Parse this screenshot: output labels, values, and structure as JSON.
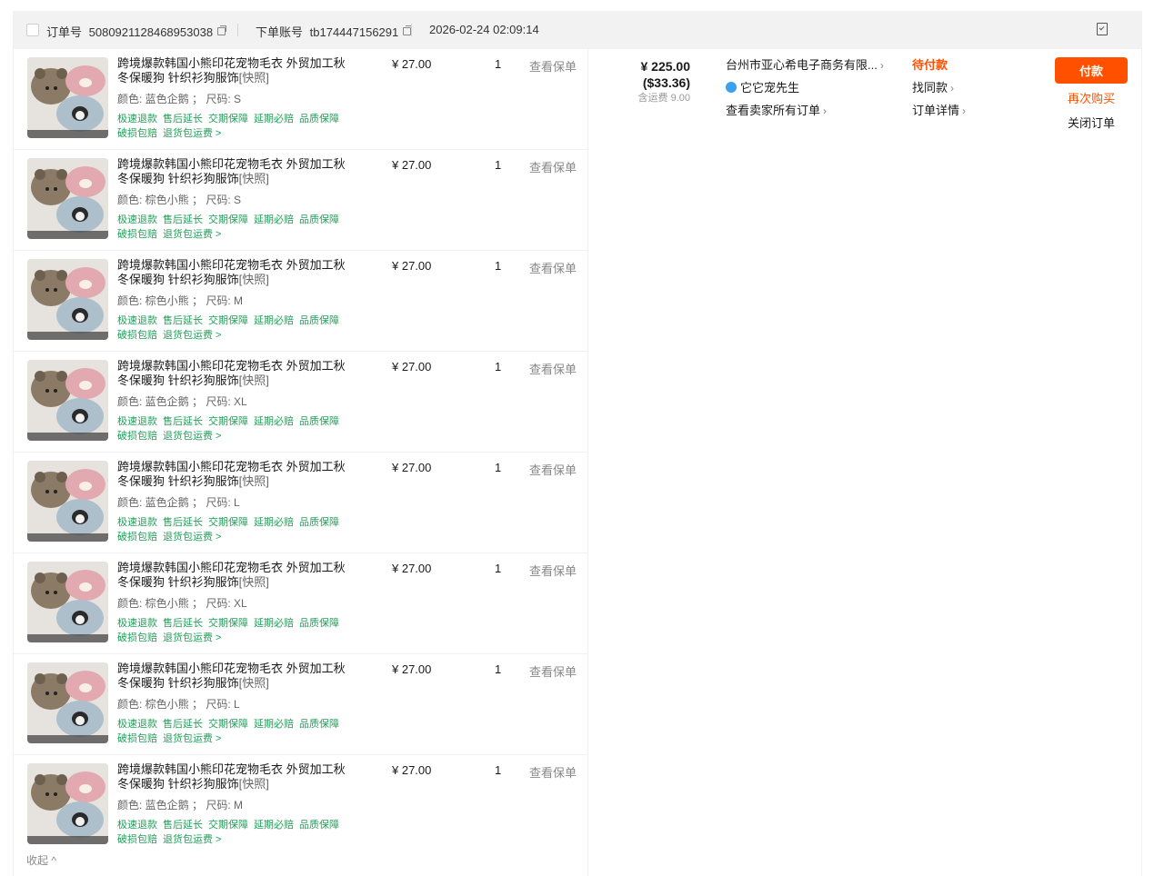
{
  "header": {
    "order_no_label": "订单号",
    "order_no": "5080921128468953038",
    "account_label": "下单账号",
    "account": "tb174447156291",
    "datetime": "2026-02-24 02:09:14"
  },
  "items": [
    {
      "title_main": "跨境爆款韩国小熊印花宠物毛衣 外贸加工秋冬保暖狗 针织衫狗服饰",
      "snapshot": "[快照]",
      "spec": "颜色: 蓝色企鹅 ；  尺码: S",
      "price": "¥ 27.00",
      "qty": "1",
      "insurance": "查看保单"
    },
    {
      "title_main": "跨境爆款韩国小熊印花宠物毛衣 外贸加工秋冬保暖狗 针织衫狗服饰",
      "snapshot": "[快照]",
      "spec": "颜色: 棕色小熊 ；  尺码: S",
      "price": "¥ 27.00",
      "qty": "1",
      "insurance": "查看保单"
    },
    {
      "title_main": "跨境爆款韩国小熊印花宠物毛衣 外贸加工秋冬保暖狗 针织衫狗服饰",
      "snapshot": "[快照]",
      "spec": "颜色: 棕色小熊 ；  尺码: M",
      "price": "¥ 27.00",
      "qty": "1",
      "insurance": "查看保单"
    },
    {
      "title_main": "跨境爆款韩国小熊印花宠物毛衣 外贸加工秋冬保暖狗 针织衫狗服饰",
      "snapshot": "[快照]",
      "spec": "颜色: 蓝色企鹅 ；  尺码: XL",
      "price": "¥ 27.00",
      "qty": "1",
      "insurance": "查看保单"
    },
    {
      "title_main": "跨境爆款韩国小熊印花宠物毛衣 外贸加工秋冬保暖狗 针织衫狗服饰",
      "snapshot": "[快照]",
      "spec": "颜色: 蓝色企鹅 ；  尺码: L",
      "price": "¥ 27.00",
      "qty": "1",
      "insurance": "查看保单"
    },
    {
      "title_main": "跨境爆款韩国小熊印花宠物毛衣 外贸加工秋冬保暖狗 针织衫狗服饰",
      "snapshot": "[快照]",
      "spec": "颜色: 棕色小熊 ；  尺码: XL",
      "price": "¥ 27.00",
      "qty": "1",
      "insurance": "查看保单"
    },
    {
      "title_main": "跨境爆款韩国小熊印花宠物毛衣 外贸加工秋冬保暖狗 针织衫狗服饰",
      "snapshot": "[快照]",
      "spec": "颜色: 棕色小熊 ；  尺码: L",
      "price": "¥ 27.00",
      "qty": "1",
      "insurance": "查看保单"
    },
    {
      "title_main": "跨境爆款韩国小熊印花宠物毛衣 外贸加工秋冬保暖狗 针织衫狗服饰",
      "snapshot": "[快照]",
      "spec": "颜色: 蓝色企鹅 ；  尺码: M",
      "price": "¥ 27.00",
      "qty": "1",
      "insurance": "查看保单"
    }
  ],
  "service_tags": [
    "极速退款",
    "售后延长",
    "交期保障",
    "延期必赔",
    "品质保障",
    "破损包赔",
    "退货包运费 >"
  ],
  "collapse_label": "收起 ^",
  "total": {
    "rmb": "¥ 225.00",
    "usd": "($33.36)",
    "shipping": "含运费 9.00"
  },
  "seller": {
    "name": "台州市亚心希电子商务有限...",
    "contact": "它它宠先生",
    "all_orders": "查看卖家所有订单"
  },
  "status": {
    "state": "待付款",
    "find_similar": "找同款",
    "details": "订单详情"
  },
  "actions": {
    "pay": "付款",
    "rebuy": "再次购买",
    "close": "关闭订单"
  },
  "colors": {
    "accent": "#ff5000",
    "tag_green": "#22a05a",
    "header_bg": "#f2f2f2"
  },
  "icons": {
    "chevron": "chevron-right-icon",
    "copy": "copy-icon",
    "flag": "bookmark-flag-icon",
    "wangwang": "chat-icon"
  }
}
